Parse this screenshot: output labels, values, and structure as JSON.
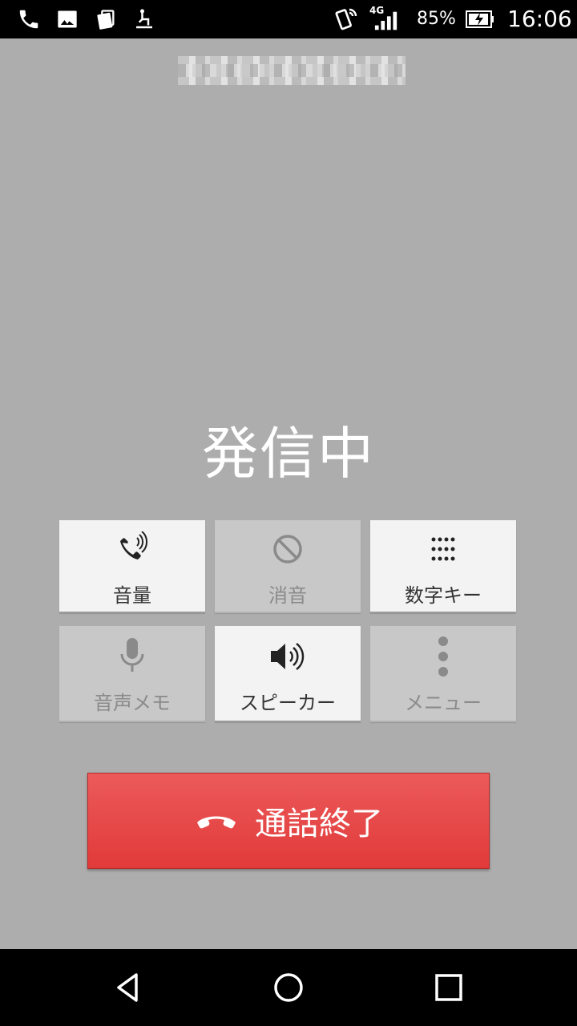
{
  "status_bar": {
    "icons": [
      "phone-icon",
      "image-icon",
      "cards-icon",
      "touch-icon",
      "vibrate-phone-icon",
      "signal-icon",
      "battery-charging-icon"
    ],
    "network": "4G",
    "battery": "85%",
    "time": "16:06"
  },
  "call": {
    "number_obscured": true,
    "status": "発信中"
  },
  "controls": {
    "volume": {
      "label": "音量",
      "icon": "volume-phone-icon",
      "enabled": true
    },
    "mute": {
      "label": "消音",
      "icon": "mute-icon",
      "enabled": false
    },
    "keypad": {
      "label": "数字キー",
      "icon": "keypad-icon",
      "enabled": true
    },
    "voice_memo": {
      "label": "音声メモ",
      "icon": "microphone-icon",
      "enabled": false
    },
    "speaker": {
      "label": "スピーカー",
      "icon": "speaker-icon",
      "enabled": true
    },
    "menu": {
      "label": "メニュー",
      "icon": "more-vert-icon",
      "enabled": false
    }
  },
  "end_call": {
    "label": "通話終了",
    "icon": "hang-up-icon",
    "color": "#e13a3a"
  },
  "nav": {
    "icons": [
      "back-icon",
      "home-icon",
      "recents-icon"
    ]
  }
}
